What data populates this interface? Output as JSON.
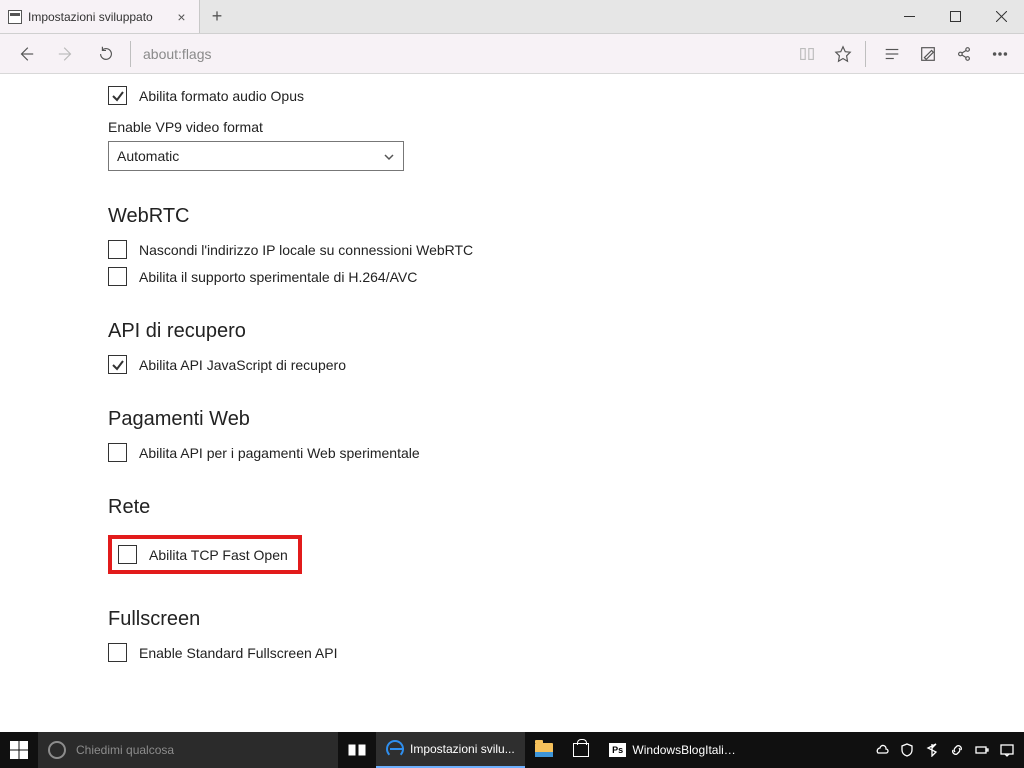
{
  "window": {
    "tab_title": "Impostazioni sviluppato",
    "url": "about:flags"
  },
  "page": {
    "opt_opus": {
      "label": "Abilita formato audio Opus",
      "checked": true
    },
    "vp9": {
      "label": "Enable VP9 video format",
      "value": "Automatic"
    },
    "sections": {
      "webrtc": {
        "title": "WebRTC",
        "opts": [
          {
            "label": "Nascondi l'indirizzo IP locale su connessioni WebRTC",
            "checked": false
          },
          {
            "label": "Abilita il supporto sperimentale di H.264/AVC",
            "checked": false
          }
        ]
      },
      "recupero": {
        "title": "API di recupero",
        "opts": [
          {
            "label": "Abilita API JavaScript di recupero",
            "checked": true
          }
        ]
      },
      "pagamenti": {
        "title": "Pagamenti Web",
        "opts": [
          {
            "label": "Abilita API per i pagamenti Web sperimentale",
            "checked": false
          }
        ]
      },
      "rete": {
        "title": "Rete",
        "opts": [
          {
            "label": "Abilita TCP Fast Open",
            "checked": false
          }
        ]
      },
      "fullscreen": {
        "title": "Fullscreen",
        "opts": [
          {
            "label": "Enable Standard Fullscreen API",
            "checked": false
          }
        ]
      }
    }
  },
  "taskbar": {
    "cortana_placeholder": "Chiedimi qualcosa",
    "tasks": {
      "edge": "Impostazioni svilu...",
      "ps": "WindowsBlogItalia..."
    }
  }
}
